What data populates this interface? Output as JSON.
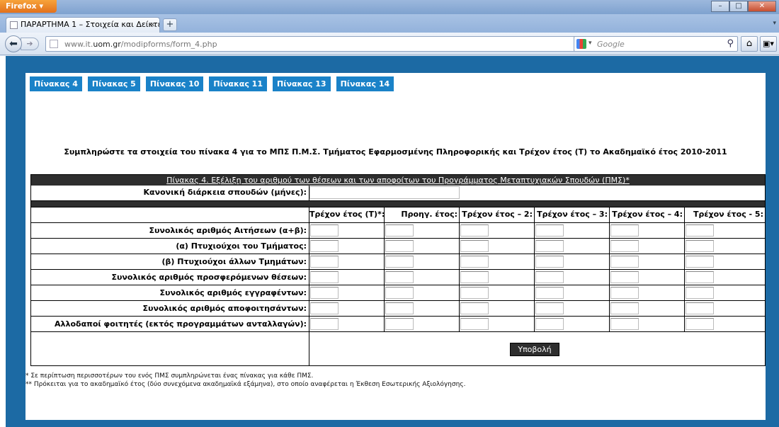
{
  "browser": {
    "app_button": "Firefox",
    "tab_title": "ΠΑΡΑΡΤΗΜΑ 1 – Στοιχεία και Δείκτες τ...",
    "url_host": "www.it.",
    "url_bold": "uom.gr",
    "url_path": "/modipforms/form_4.php",
    "search_placeholder": "Google"
  },
  "page": {
    "tabs": [
      "Πίνακας 4",
      "Πίνακας 5",
      "Πίνακας 10",
      "Πίνακας 11",
      "Πίνακας 13",
      "Πίνακας 14"
    ],
    "instruction": "Συμπληρώστε τα στοιχεία του πίνακα 4 για το ΜΠΣ Π.Μ.Σ. Τμήματος Εφαρμοσμένης Πληροφορικής και Τρέχον έτος (Τ) το Ακαδημαϊκό έτος 2010-2011",
    "table_caption": "Πίνακας 4. Εξέλιξη του αριθμού των θέσεων και των αποφοίτων του Προγράμματος Μεταπτυχιακών Σπουδών (ΠΜΣ)*",
    "duration_label": "Κανονική διάρκεια σπουδών (μήνες):",
    "year_headers": [
      "Τρέχον έτος (Τ)*:",
      "Προηγ. έτος:",
      "Τρέχον έτος – 2:",
      "Τρέχον έτος – 3:",
      "Τρέχον έτος – 4:",
      "Τρέχον έτος - 5:"
    ],
    "rows": [
      "Συνολικός αριθμός Αιτήσεων (α+β):",
      "(α) Πτυχιούχοι του Τμήματος:",
      "(β) Πτυχιούχοι άλλων Τμημάτων:",
      "Συνολικός αριθμός προσφερόμενων θέσεων:",
      "Συνολικός αριθμός εγγραφέντων:",
      "Συνολικός αριθμός αποφοιτησάντων:",
      "Αλλοδαποί φοιτητές (εκτός προγραμμάτων ανταλλαγών):"
    ],
    "submit_label": "Υποβολή",
    "footnote_1": "* Σε περίπτωση περισσοτέρων του ενός ΠΜΣ συμπληρώνεται ένας πίνακας για κάθε ΠΜΣ.",
    "footnote_2": "** Πρόκειται για το ακαδημαϊκό έτος (δύο συνεχόμενα ακαδημαϊκά εξάμηνα), στο οποίο αναφέρεται η Έκθεση Εσωτερικής Αξιολόγησης."
  }
}
